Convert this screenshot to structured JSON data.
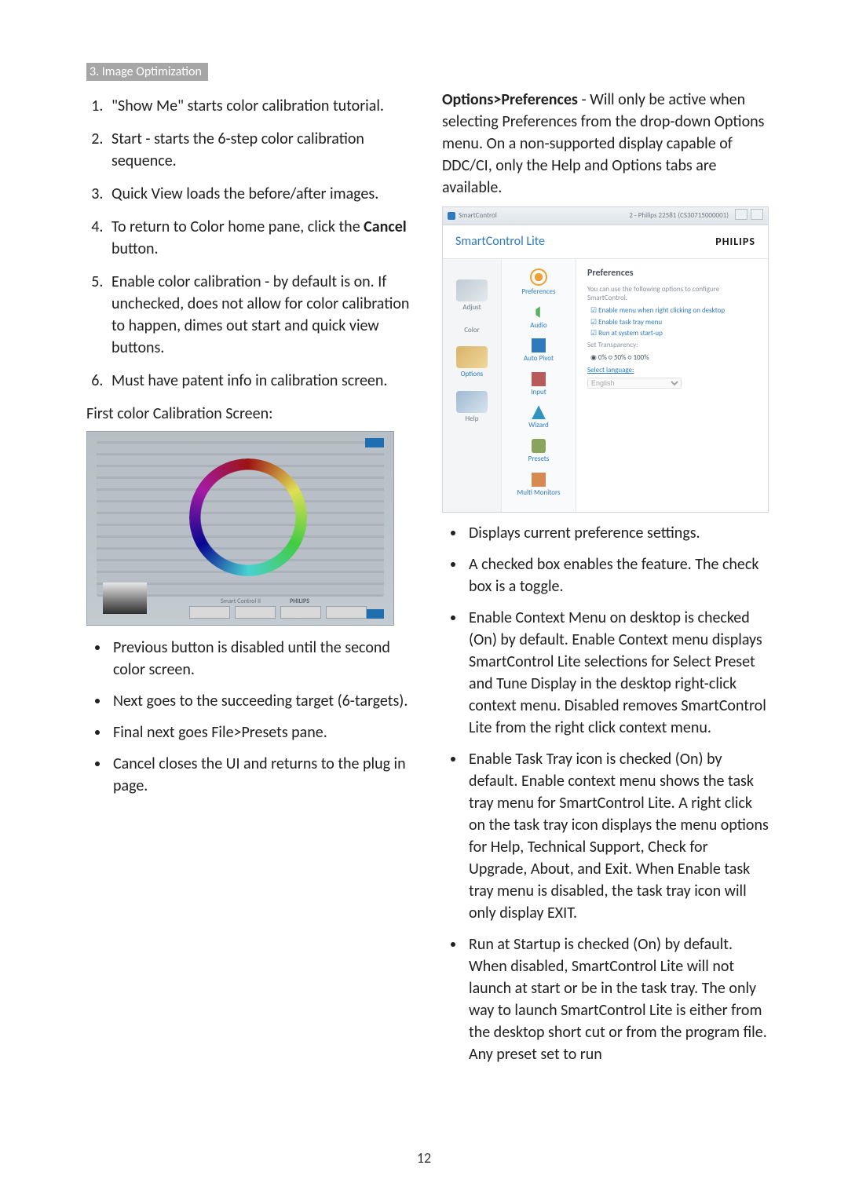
{
  "header": "3. Image Optimization",
  "steps": [
    "\"Show Me\" starts color calibration tutorial.",
    "Start - starts the 6-step color calibration sequence.",
    "Quick View loads the before/after images.",
    "To return to Color home pane, click the <b>Cancel</b> button.",
    "Enable color calibration - by default is on. If unchecked, does not allow for color calibration to happen, dimes out start and quick view buttons.",
    "Must have patent info in calibration screen."
  ],
  "subhead_left": "First color Calibration Screen:",
  "shot1": {
    "caption_left": "Smart Control II",
    "caption_right": "PHILIPS"
  },
  "left_bullets": [
    "Previous button is disabled until the second color screen.",
    "Next goes to the succeeding target (6-targets).",
    "Final next goes File>Presets pane.",
    "Cancel closes the UI and returns to the plug in page."
  ],
  "right_intro": "<b>Options>Preferences</b> - Will only be active when selecting Preferences from the drop-down Options menu. On a non-supported display capable of DDC/CI, only the Help and Options tabs are available.",
  "shot2": {
    "titlebar_app": "SmartControl",
    "titlebar_info": "2 - Philips 22581 (CS30715000001)",
    "titlebar_btns": [
      "?",
      "×"
    ],
    "app_title": "SmartControl Lite",
    "brand": "PHILIPS",
    "nav": [
      {
        "name": "Adjust"
      },
      {
        "name": "Color"
      },
      {
        "name": "Options"
      },
      {
        "name": "Help"
      }
    ],
    "subnav": [
      {
        "name": "Preferences",
        "color": "#f0a030"
      },
      {
        "name": "Audio",
        "color": "#58b15c"
      },
      {
        "name": "Auto Pivot",
        "color": "#2f7abf"
      },
      {
        "name": "Input",
        "color": "#b85b5b"
      },
      {
        "name": "Wizard",
        "color": "#2f95bf"
      },
      {
        "name": "Presets",
        "color": "#8aa35d"
      },
      {
        "name": "Multi Monitors",
        "color": "#d68a4f"
      }
    ],
    "panel_title": "Preferences",
    "panel_hint": "You can use the following options to configure SmartControl.",
    "checks": [
      "Enable menu when right clicking on desktop",
      "Enable task tray menu",
      "Run at system start-up"
    ],
    "trans_label": "Set Transparency:",
    "trans_opts": "◉ 0%   ○ 50%   ○ 100%",
    "lang_label": "Select language:",
    "lang_value": "English"
  },
  "right_bullets": [
    "Displays current preference settings.",
    "A checked box enables the feature. The check box is a toggle.",
    "Enable Context Menu on desktop is checked (On) by default. Enable Context menu displays SmartControl Lite selections for Select Preset and Tune Display in the desktop right-click context menu. Disabled removes SmartControl Lite from the right click context menu.",
    "Enable Task Tray icon is checked (On) by default. Enable context menu shows the task tray menu for SmartControl Lite. A right click on the task tray icon displays the menu options for Help, Technical Support, Check for Upgrade, About, and Exit. When Enable task tray menu is disabled, the task tray icon will only display EXIT.",
    "Run at Startup is checked (On) by default. When disabled, SmartControl Lite will not launch at start or be in the task tray. The only way to launch SmartControl Lite is either from the desktop short cut or from the program file. Any preset set to run"
  ],
  "page_number": "12"
}
